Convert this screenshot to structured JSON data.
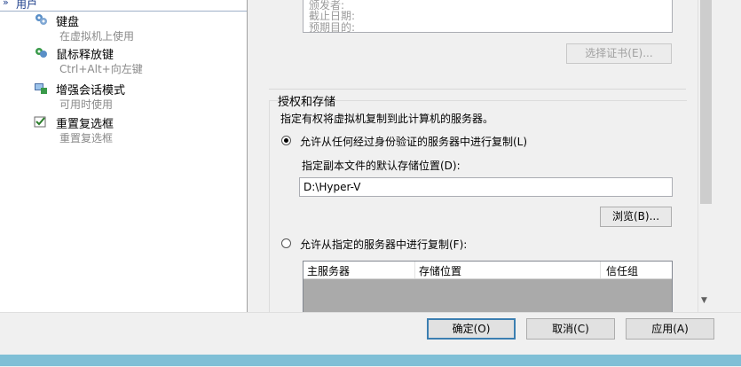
{
  "left_nav": {
    "section_label": "用户",
    "items": [
      {
        "title": "键盘",
        "subtitle": "在虚拟机上使用",
        "icon": "keyboard-icon"
      },
      {
        "title": "鼠标释放键",
        "subtitle": "Ctrl+Alt+向左键",
        "icon": "mouse-icon"
      },
      {
        "title": "增强会话模式",
        "subtitle": "可用时使用",
        "icon": "session-icon"
      },
      {
        "title": "重置复选框",
        "subtitle": "重置复选框",
        "icon": "checkbox-reset-icon"
      }
    ]
  },
  "certificate": {
    "lines": [
      "颁发者:",
      "截止日期:",
      "预期目的:"
    ],
    "select_button": "选择证书(E)..."
  },
  "authorization": {
    "group_title": "授权和存储",
    "description": "指定有权将虚拟机复制到此计算机的服务器。",
    "option_any": "允许从任何经过身份验证的服务器中进行复制(L)",
    "default_location_label": "指定副本文件的默认存储位置(D):",
    "default_location_value": "D:\\Hyper-V",
    "browse_button": "浏览(B)...",
    "option_specified": "允许从指定的服务器中进行复制(F):",
    "table_headers": [
      "主服务器",
      "存储位置",
      "信任组"
    ]
  },
  "footer": {
    "ok": "确定(O)",
    "cancel": "取消(C)",
    "apply": "应用(A)"
  }
}
